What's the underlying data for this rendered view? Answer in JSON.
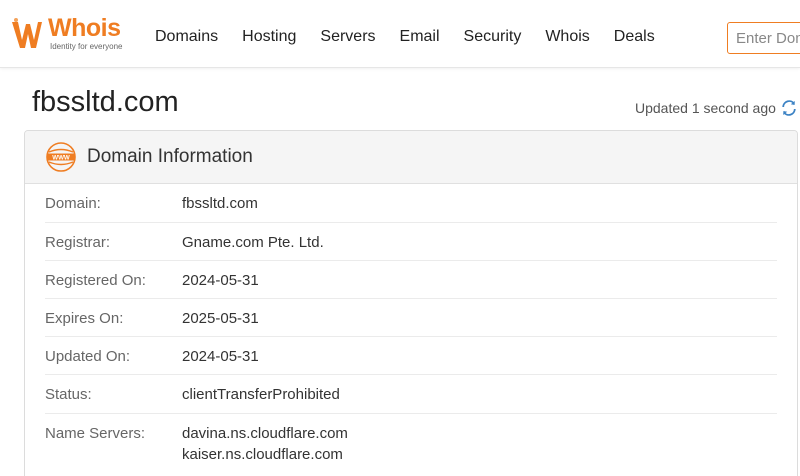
{
  "brand": {
    "name": "Whois",
    "tagline": "Identity for everyone",
    "accent": "#ef7d22"
  },
  "nav": {
    "items": [
      "Domains",
      "Hosting",
      "Servers",
      "Email",
      "Security",
      "Whois",
      "Deals"
    ]
  },
  "search": {
    "placeholder": "Enter Domain"
  },
  "page": {
    "title": "fbssltd.com",
    "updated": "Updated 1 second ago"
  },
  "card": {
    "title": "Domain Information",
    "icon_text": "WWW",
    "rows": [
      {
        "label": "Domain:",
        "value": "fbssltd.com"
      },
      {
        "label": "Registrar:",
        "value": "Gname.com Pte. Ltd."
      },
      {
        "label": "Registered On:",
        "value": "2024-05-31"
      },
      {
        "label": "Expires On:",
        "value": "2025-05-31"
      },
      {
        "label": "Updated On:",
        "value": "2024-05-31"
      },
      {
        "label": "Status:",
        "value": "clientTransferProhibited"
      },
      {
        "label": "Name Servers:",
        "values": [
          "davina.ns.cloudflare.com",
          "kaiser.ns.cloudflare.com"
        ]
      }
    ]
  }
}
